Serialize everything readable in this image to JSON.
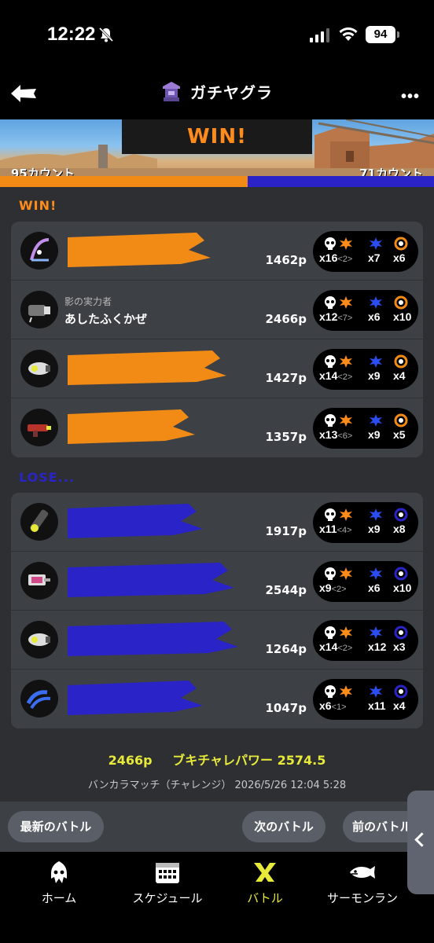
{
  "status_bar": {
    "time": "12:22",
    "battery": "94"
  },
  "header": {
    "title": "ガチヤグラ"
  },
  "banner": {
    "result": "WIN!",
    "left_count": "95カウント",
    "right_count": "71カウント"
  },
  "score_ratio": 0.57,
  "colors": {
    "win": "#f28b16",
    "lose": "#2a24c8",
    "accent": "#e8ea3a"
  },
  "teams": {
    "win": {
      "label": "WIN!",
      "players": [
        {
          "weapon": "stringer-weapon-icon",
          "byname": "",
          "name": "",
          "points": "1462p",
          "ka": "x16",
          "assist": "<2>",
          "sp": "x7",
          "special": "x6"
        },
        {
          "weapon": "splatana-weapon-icon",
          "byname": "影の実力者",
          "name": "あしたふくかぜ",
          "points": "2466p",
          "ka": "x12",
          "assist": "<7>",
          "sp": "x6",
          "special": "x10"
        },
        {
          "weapon": "blaster-weapon-icon",
          "byname": "",
          "name": "",
          "points": "1427p",
          "ka": "x14",
          "assist": "<2>",
          "sp": "x9",
          "special": "x4"
        },
        {
          "weapon": "shooter-weapon-icon",
          "byname": "",
          "name": "",
          "points": "1357p",
          "ka": "x13",
          "assist": "<6>",
          "sp": "x9",
          "special": "x5"
        }
      ]
    },
    "lose": {
      "label": "LOSE...",
      "players": [
        {
          "weapon": "splatling-weapon-icon",
          "byname": "",
          "name": "",
          "points": "1917p",
          "ka": "x11",
          "assist": "<4>",
          "sp": "x9",
          "special": "x8"
        },
        {
          "weapon": "roller-weapon-icon",
          "byname": "",
          "name": "",
          "points": "2544p",
          "ka": "x9",
          "assist": "<2>",
          "sp": "x6",
          "special": "x10"
        },
        {
          "weapon": "blaster-weapon-icon",
          "byname": "",
          "name": "",
          "points": "1264p",
          "ka": "x14",
          "assist": "<2>",
          "sp": "x12",
          "special": "x3"
        },
        {
          "weapon": "dualies-weapon-icon",
          "byname": "",
          "name": "",
          "points": "1047p",
          "ka": "x6",
          "assist": "<1>",
          "sp": "x11",
          "special": "x4"
        }
      ]
    }
  },
  "footer": {
    "points": "2466p",
    "power": "ブキチャレパワー 2574.5",
    "match_info": "バンカラマッチ（チャレンジ） 2026/5/26 12:04 5:28"
  },
  "buttons": {
    "latest": "最新のバトル",
    "next": "次のバトル",
    "prev": "前のバトル"
  },
  "tabs": [
    {
      "label": "ホーム",
      "icon": "squid-home-icon"
    },
    {
      "label": "スケジュール",
      "icon": "calendar-icon"
    },
    {
      "label": "バトル",
      "icon": "battle-icon",
      "active": true
    },
    {
      "label": "サーモンラン",
      "icon": "salmon-icon"
    }
  ]
}
